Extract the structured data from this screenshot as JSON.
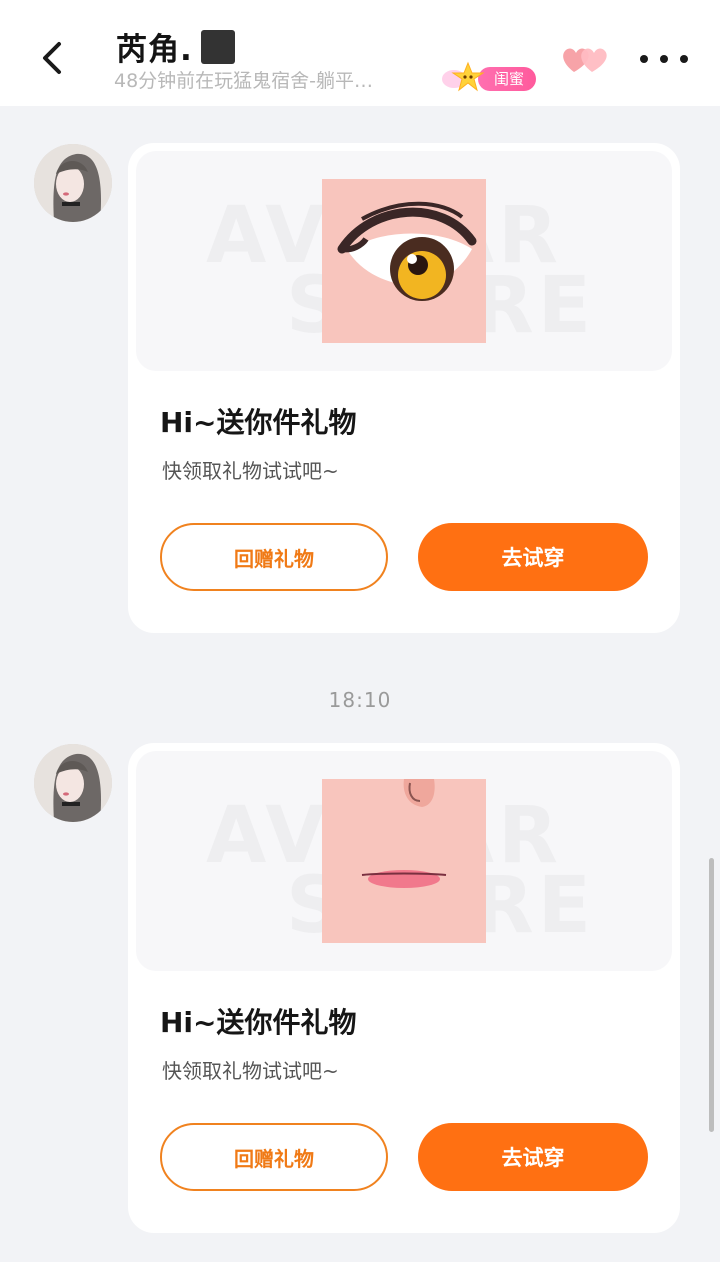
{
  "header": {
    "title": "芮角.",
    "subtitle": "48分钟前在玩猛鬼宿舍-躺平…",
    "friend_tag": "闺蜜"
  },
  "messages": [
    {
      "title": "Hi~送你件礼物",
      "desc": "快领取礼物试试吧~",
      "return_gift_label": "回赠礼物",
      "try_on_label": "去试穿",
      "item": "eye"
    },
    {
      "timestamp": "18:10",
      "title": "Hi~送你件礼物",
      "desc": "快领取礼物试试吧~",
      "return_gift_label": "回赠礼物",
      "try_on_label": "去试穿",
      "item": "lips"
    }
  ],
  "colors": {
    "accent": "#ff7012",
    "background": "#f2f3f6",
    "tag_pink": "#ff5a9c"
  },
  "icons": [
    "back-arrow-icon",
    "hearts-icon",
    "more-icon",
    "star-icon"
  ]
}
